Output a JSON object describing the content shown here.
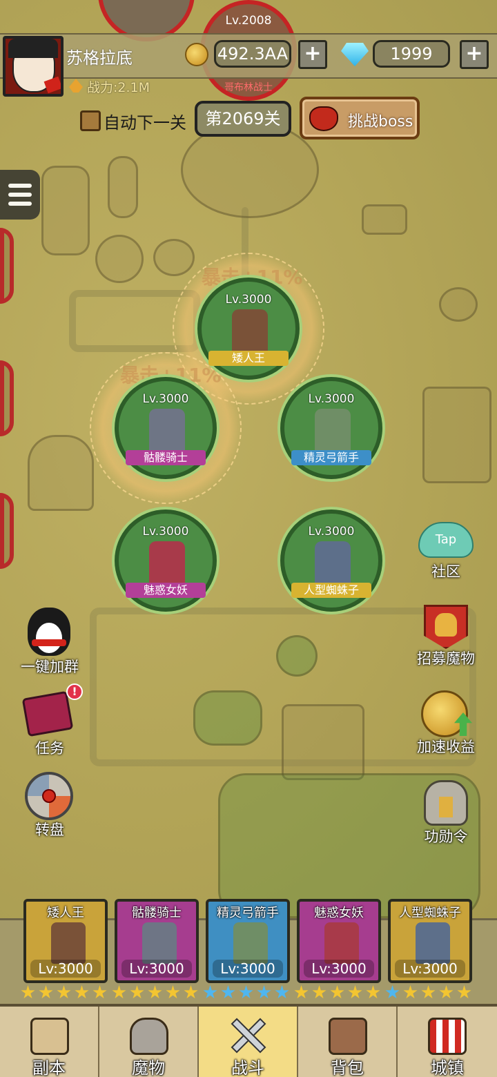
{
  "player": {
    "name": "苏格拉底",
    "power": "战力:2.1M"
  },
  "currency": {
    "gold": "492.3AA",
    "gems": "1999",
    "plus": "+"
  },
  "top_enemy": {
    "level": "Lv.2008",
    "name": "哥布林战士"
  },
  "stage": {
    "auto_next_label": "自动下一关",
    "current": "第2069关",
    "boss_button": "挑战boss"
  },
  "crit_text": "暴击+11%",
  "units": [
    {
      "name": "矮人王",
      "level": "Lv.3000",
      "color": "#d8b331"
    },
    {
      "name": "骷髅骑士",
      "level": "Lv.3000",
      "color": "#b33f98"
    },
    {
      "name": "精灵弓箭手",
      "level": "Lv.3000",
      "color": "#3d8fc8"
    },
    {
      "name": "魅惑女妖",
      "level": "Lv.3000",
      "color": "#b33f98"
    },
    {
      "name": "人型蜘蛛子",
      "level": "Lv.3000",
      "color": "#d8b331"
    }
  ],
  "left_buttons": {
    "qq": "一键加群",
    "quest": "任务",
    "wheel": "转盘",
    "quest_badge": "!"
  },
  "right_buttons": {
    "community": "社区",
    "tap_icon_text": "Tap",
    "recruit": "招募魔物",
    "speed": "加速收益",
    "merit": "功勋令"
  },
  "bench": [
    {
      "name": "矮人王",
      "level": "Lv:3000",
      "bg": "#c9a33a",
      "stars": "gold"
    },
    {
      "name": "骷髅骑士",
      "level": "Lv:3000",
      "bg": "#a63d8f",
      "stars": "gold"
    },
    {
      "name": "精灵弓箭手",
      "level": "Lv:3000",
      "bg": "#3f8fc2",
      "stars": "blue"
    },
    {
      "name": "魅惑女妖",
      "level": "Lv:3000",
      "bg": "#a63d8f",
      "stars": "gold"
    },
    {
      "name": "人型蜘蛛子",
      "level": "Lv:3000",
      "bg": "#c9a33a",
      "stars": "blue_gold"
    }
  ],
  "nav": [
    {
      "label": "副本",
      "icon": "map-icon"
    },
    {
      "label": "魔物",
      "icon": "helmet-icon"
    },
    {
      "label": "战斗",
      "icon": "crossed-swords-icon",
      "active": true
    },
    {
      "label": "背包",
      "icon": "backpack-icon"
    },
    {
      "label": "城镇",
      "icon": "shop-icon"
    }
  ]
}
